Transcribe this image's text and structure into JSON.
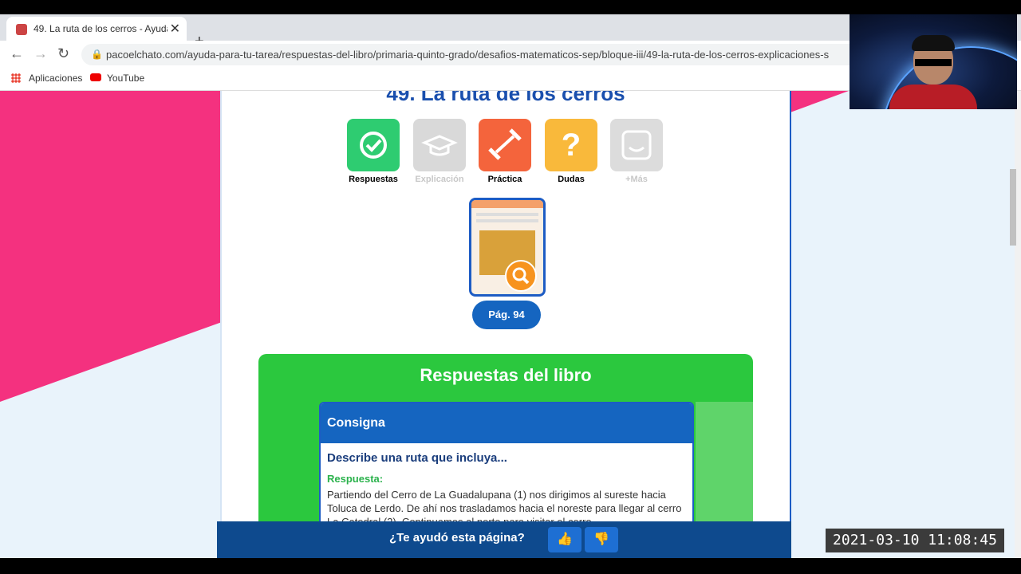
{
  "browser": {
    "tab_title": "49. La ruta de los cerros - Ayuda",
    "tab_close": "✕",
    "new_tab": "+",
    "url": "pacoelchato.com/ayuda-para-tu-tarea/respuestas-del-libro/primaria-quinto-grado/desafios-matematicos-sep/bloque-iii/49-la-ruta-de-los-cerros-explicaciones-s",
    "bookmarks": [
      "Aplicaciones",
      "YouTube"
    ]
  },
  "page": {
    "heading": "49. La ruta de los cerros",
    "icons": [
      {
        "label": "Respuestas",
        "color": "#2ecc71",
        "label_color": "#1a3d7c"
      },
      {
        "label": "Explicación",
        "color": "#d9d9d9",
        "label_color": "#c8c8c8"
      },
      {
        "label": "Práctica",
        "color": "#f4643c",
        "label_color": "#1a3d7c"
      },
      {
        "label": "Dudas",
        "color": "#f9b93b",
        "label_color": "#1a3d7c"
      },
      {
        "label": "+Más",
        "color": "#dcdcdc",
        "label_color": "#c8c8c8"
      }
    ],
    "page_button": "Pág. 94",
    "answers_title": "Respuestas del libro",
    "consigna_header": "Consigna",
    "question": "Describe una ruta que incluya...",
    "answer_label": "Respuesta:",
    "answer_text": "Partiendo del Cerro de La Guadalupana (1) nos dirigimos al sureste hacia Toluca de Lerdo. De ahí nos trasladamos hacia el noreste para llegar al cerro La Catedral (2). Continuamos al norte para visitar el cerro"
  },
  "feedback": {
    "question": "¿Te ayudó esta página?",
    "up": "👍",
    "down": "👎"
  },
  "overlay": {
    "timestamp": "2021-03-10  11:08:45"
  }
}
